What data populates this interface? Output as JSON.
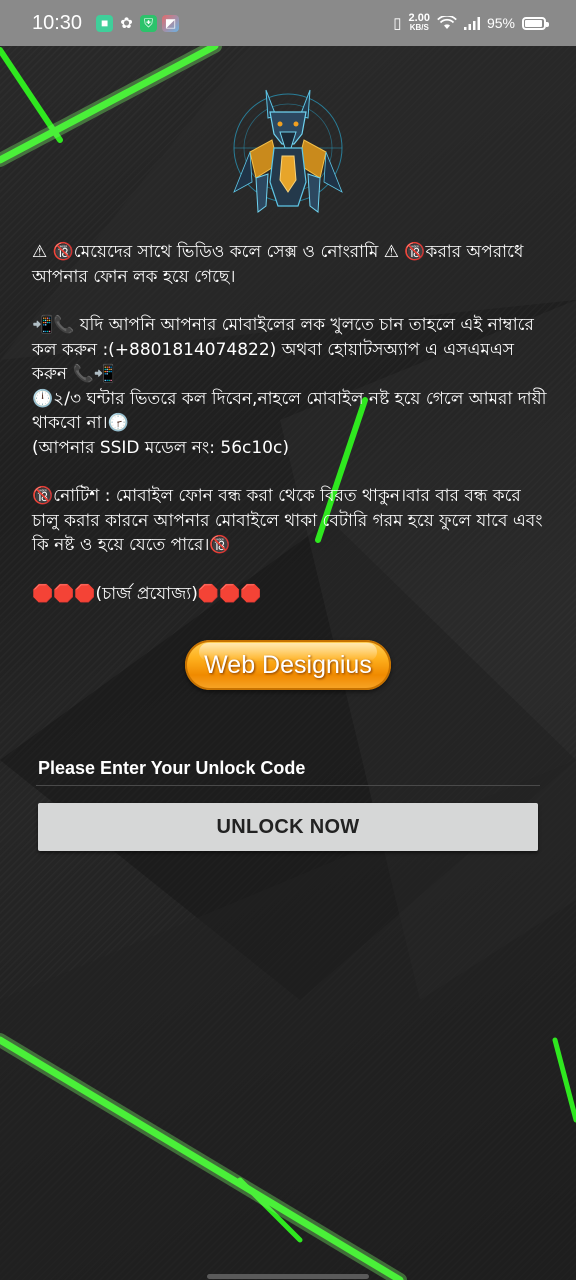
{
  "status_bar": {
    "time": "10:30",
    "notification_icons": [
      "app-icon",
      "android-debug-icon",
      "shield-icon",
      "gallery-icon"
    ],
    "net_speed_value": "2.00",
    "net_speed_unit": "KB/S",
    "battery_percent": "95%",
    "battery_level": 0.95
  },
  "message": {
    "line1": "⚠ 🔞মেয়েদের সাথে ভিডিও কলে সেক্স ও নোংরামি ⚠ 🔞করার অপরাধে আপনার ফোন লক হয়ে গেছে।",
    "line2": "📲📞 যদি আপনি আপনার মোবাইলের লক খুলতে চান তাহলে এই নাম্বারে কল করুন :(+8801814074822) অথবা হোয়াটসঅ্যাপ এ এসএমএস করুন 📞📲",
    "line3": "🕛২/৩ ঘন্টার ভিতরে কল দিবেন,নাহলে মোবাইল নষ্ট হয়ে গেলে আমরা দায়ী থাকবো না।🕝",
    "line4": "(আপনার SSID মডেল নং: 56c10c)",
    "line5": "🔞নোটিশ : মোবাইল ফোন বন্ধ করা থেকে বিরত থাকুন।বার বার বন্ধ করে চালু করার কারনে আপনার মোবাইলে থাকা বেটারি গরম হয়ে ফুলে যাবে এবং কি নষ্ট ও হয়ে যেতে পারে।🔞",
    "line6": "🛑🛑🛑(চার্জ প্রযোজ্য)🛑🛑🛑"
  },
  "brand_button": {
    "label": "Web Designius"
  },
  "unlock_form": {
    "placeholder": "Please Enter Your Unlock Code",
    "value": "",
    "button_label": "UNLOCK NOW"
  },
  "colors": {
    "accent_green": "#22e01a",
    "status_bar": "#8a8a8a",
    "button_gray": "#d6d7d7",
    "brand_orange": "#f7a21b"
  }
}
